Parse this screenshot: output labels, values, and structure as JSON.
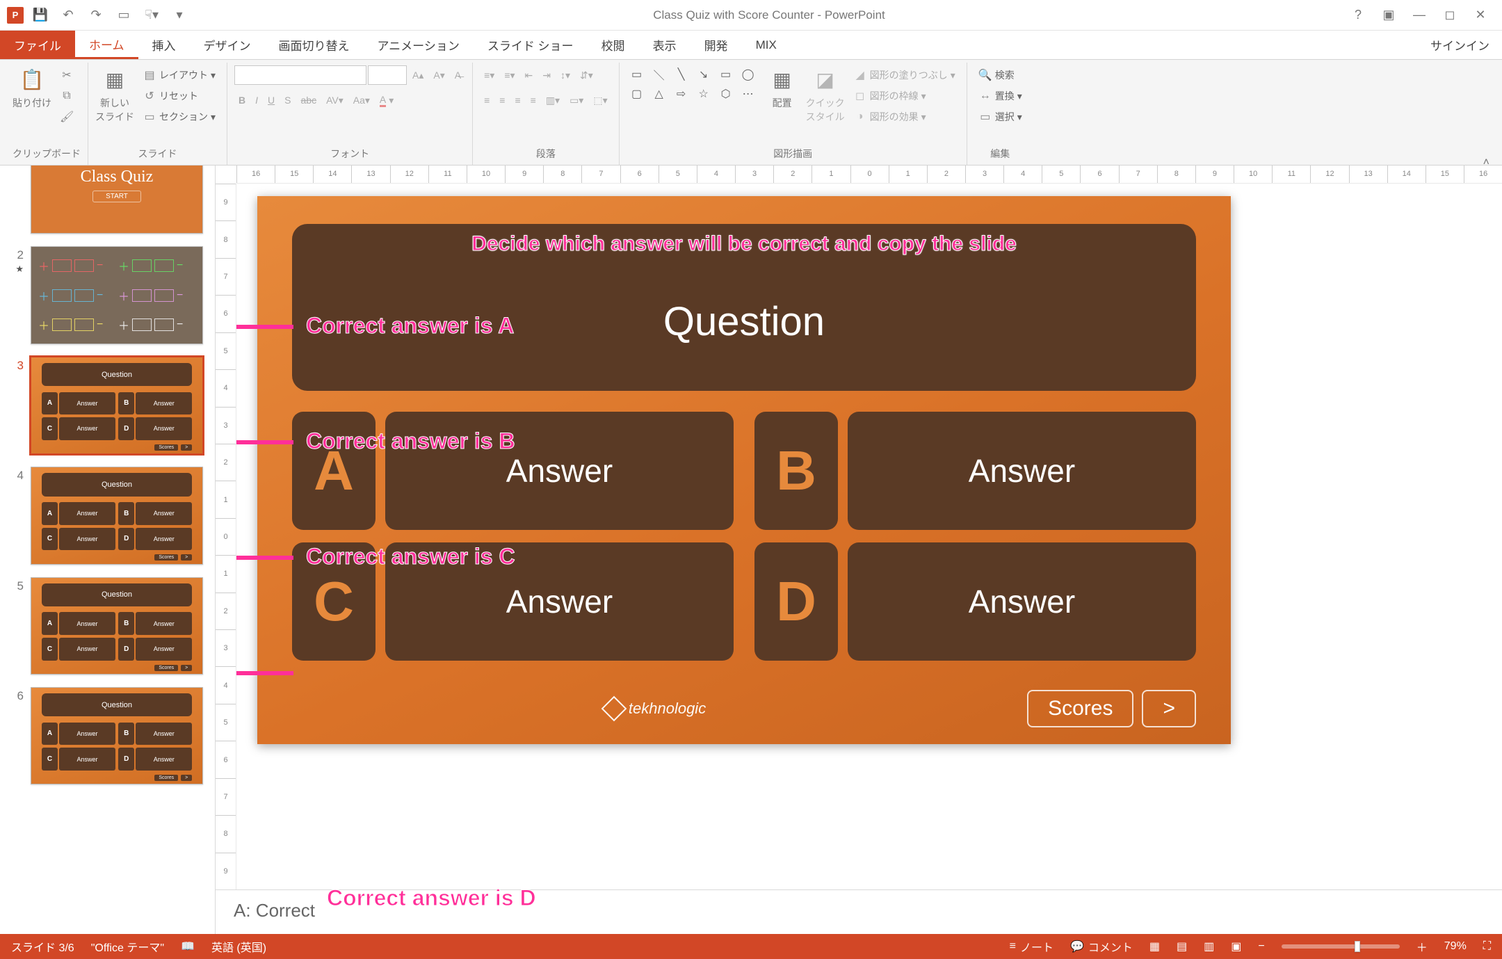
{
  "title": "Class Quiz with Score Counter - PowerPoint",
  "tabs": {
    "file": "ファイル",
    "home": "ホーム",
    "insert": "挿入",
    "design": "デザイン",
    "transitions": "画面切り替え",
    "animations": "アニメーション",
    "slideshow": "スライド ショー",
    "review": "校閲",
    "view": "表示",
    "developer": "開発",
    "mix": "MIX"
  },
  "signin": "サインイン",
  "ribbon": {
    "clipboard": {
      "paste": "貼り付け",
      "label": "クリップボード"
    },
    "slides": {
      "newslide": "新しい\nスライド",
      "layout": "レイアウト",
      "reset": "リセット",
      "section": "セクション",
      "label": "スライド"
    },
    "font": {
      "label": "フォント"
    },
    "paragraph": {
      "label": "段落"
    },
    "drawing": {
      "arrange": "配置",
      "quickstyles": "クイック\nスタイル",
      "fill": "図形の塗りつぶし",
      "outline": "図形の枠線",
      "effects": "図形の効果",
      "label": "図形描画"
    },
    "editing": {
      "find": "検索",
      "replace": "置換",
      "select": "選択",
      "label": "編集"
    }
  },
  "ruler_h": [
    "16",
    "15",
    "14",
    "13",
    "12",
    "11",
    "10",
    "9",
    "8",
    "7",
    "6",
    "5",
    "4",
    "3",
    "2",
    "1",
    "0",
    "1",
    "2",
    "3",
    "4",
    "5",
    "6",
    "7",
    "8",
    "9",
    "10",
    "11",
    "12",
    "13",
    "14",
    "15",
    "16"
  ],
  "ruler_v": [
    "9",
    "8",
    "7",
    "6",
    "5",
    "4",
    "3",
    "2",
    "1",
    "0",
    "1",
    "2",
    "3",
    "4",
    "5",
    "6",
    "7",
    "8",
    "9"
  ],
  "thumbnails": {
    "t1": {
      "num": "",
      "title": "Class Quiz",
      "button": "START"
    },
    "t2": {
      "num": "2"
    },
    "t3": {
      "num": "3",
      "q": "Question",
      "letters": [
        "A",
        "B",
        "C",
        "D"
      ],
      "ans": "Answer",
      "scores": "Scores",
      "next": ">"
    },
    "t4": {
      "num": "4",
      "q": "Question",
      "letters": [
        "A",
        "B",
        "C",
        "D"
      ],
      "ans": "Answer"
    },
    "t5": {
      "num": "5",
      "q": "Question",
      "letters": [
        "A",
        "B",
        "C",
        "D"
      ],
      "ans": "Answer"
    },
    "t6": {
      "num": "6",
      "q": "Question",
      "letters": [
        "A",
        "B",
        "C",
        "D"
      ],
      "ans": "Answer"
    }
  },
  "slide": {
    "hint": "Decide which answer will be correct and copy the slide",
    "question": "Question",
    "answers": {
      "A": "Answer",
      "B": "Answer",
      "C": "Answer",
      "D": "Answer"
    },
    "brand": "tekhnologic",
    "scores": "Scores",
    "next": ">"
  },
  "annotations": {
    "a": "Correct answer is A",
    "b": "Correct answer is B",
    "c": "Correct answer is C",
    "d": "Correct answer is D"
  },
  "notes": "A: Correct",
  "status": {
    "slide": "スライド 3/6",
    "theme": "\"Office テーマ\"",
    "lang": "英語 (英国)",
    "notes_btn": "ノート",
    "comments_btn": "コメント",
    "zoom": "79%"
  }
}
